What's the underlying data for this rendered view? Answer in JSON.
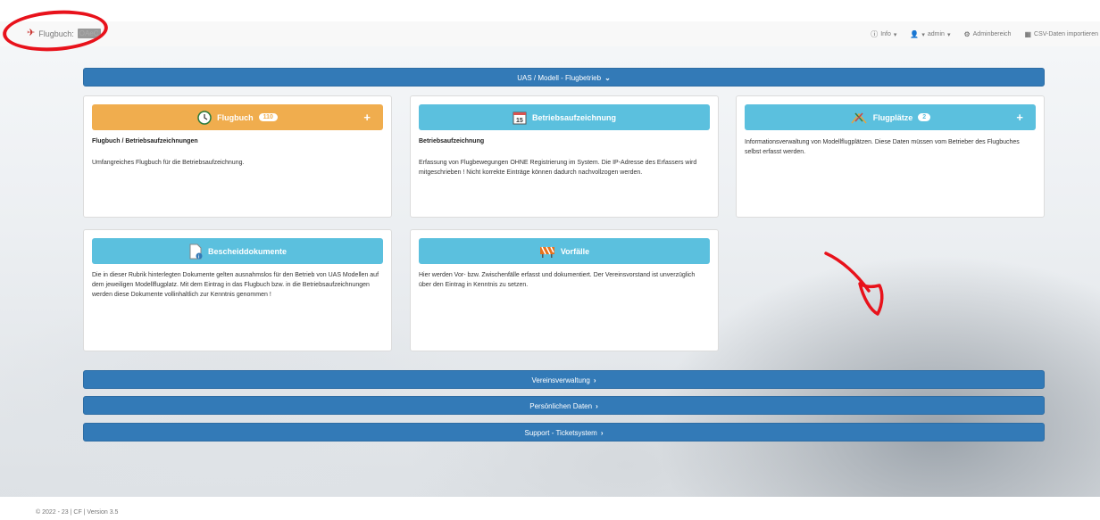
{
  "brand": {
    "name": "Flugbuch:",
    "redacted_text": "OAeC",
    "icon": "airplane-icon"
  },
  "nav": {
    "info": "Info",
    "admin": "admin",
    "adminbereich": "Adminbereich",
    "csv_import": "CSV-Daten importieren"
  },
  "sections": {
    "uas": "UAS / Modell - Flugbetrieb",
    "verein": "Vereinsverwaltung",
    "persoenlich": "Persönlichen Daten",
    "support": "Support - Ticketsystem"
  },
  "panels": {
    "flugbuch": {
      "title": "Flugbuch",
      "badge": "110",
      "subtitle": "Flugbuch / Betriebsaufzeichnungen",
      "text": "Umfangreiches Flugbuch für die Betriebsaufzeichnung."
    },
    "betrieb": {
      "title": "Betriebsaufzeichnung",
      "subtitle": "Betriebsaufzeichnung",
      "text": "Erfassung von Flugbewegungen OHNE Registrierung im System. Die IP-Adresse des Erfassers wird mitgeschrieben ! Nicht korrekte Einträge können dadurch nachvollzogen werden."
    },
    "flugplaetze": {
      "title": "Flugplätze",
      "badge": "2",
      "text": "Informationsverwaltung von Modellflugplätzen. Diese Daten müssen vom Betrieber des Flugbuches selbst erfasst werden."
    },
    "bescheid": {
      "title": "Bescheiddokumente",
      "text": "Die in dieser Rubrik hinterlegten Dokumente gelten ausnahmslos für den Betrieb von UAS Modellen auf dem jeweiligen Modellflugplatz. Mit dem Eintrag in das Flugbuch bzw. in die Betriebsaufzeichnungen werden diese Dokumente vollinhaltlich zur Kenntnis genommen !"
    },
    "vorfaelle": {
      "title": "Vorfälle",
      "text": "Hier werden Vor- bzw. Zwischenfälle erfasst und dokumentiert. Der Vereinsvorstand ist unverzüglich über den Eintrag in Kenntnis zu setzen."
    }
  },
  "footer": "© 2022 - 23 | CF | Version 3.5",
  "colors": {
    "primary": "#337ab7",
    "warning": "#f0ad4e",
    "info": "#5bc0de",
    "annotation": "#e8121b"
  }
}
